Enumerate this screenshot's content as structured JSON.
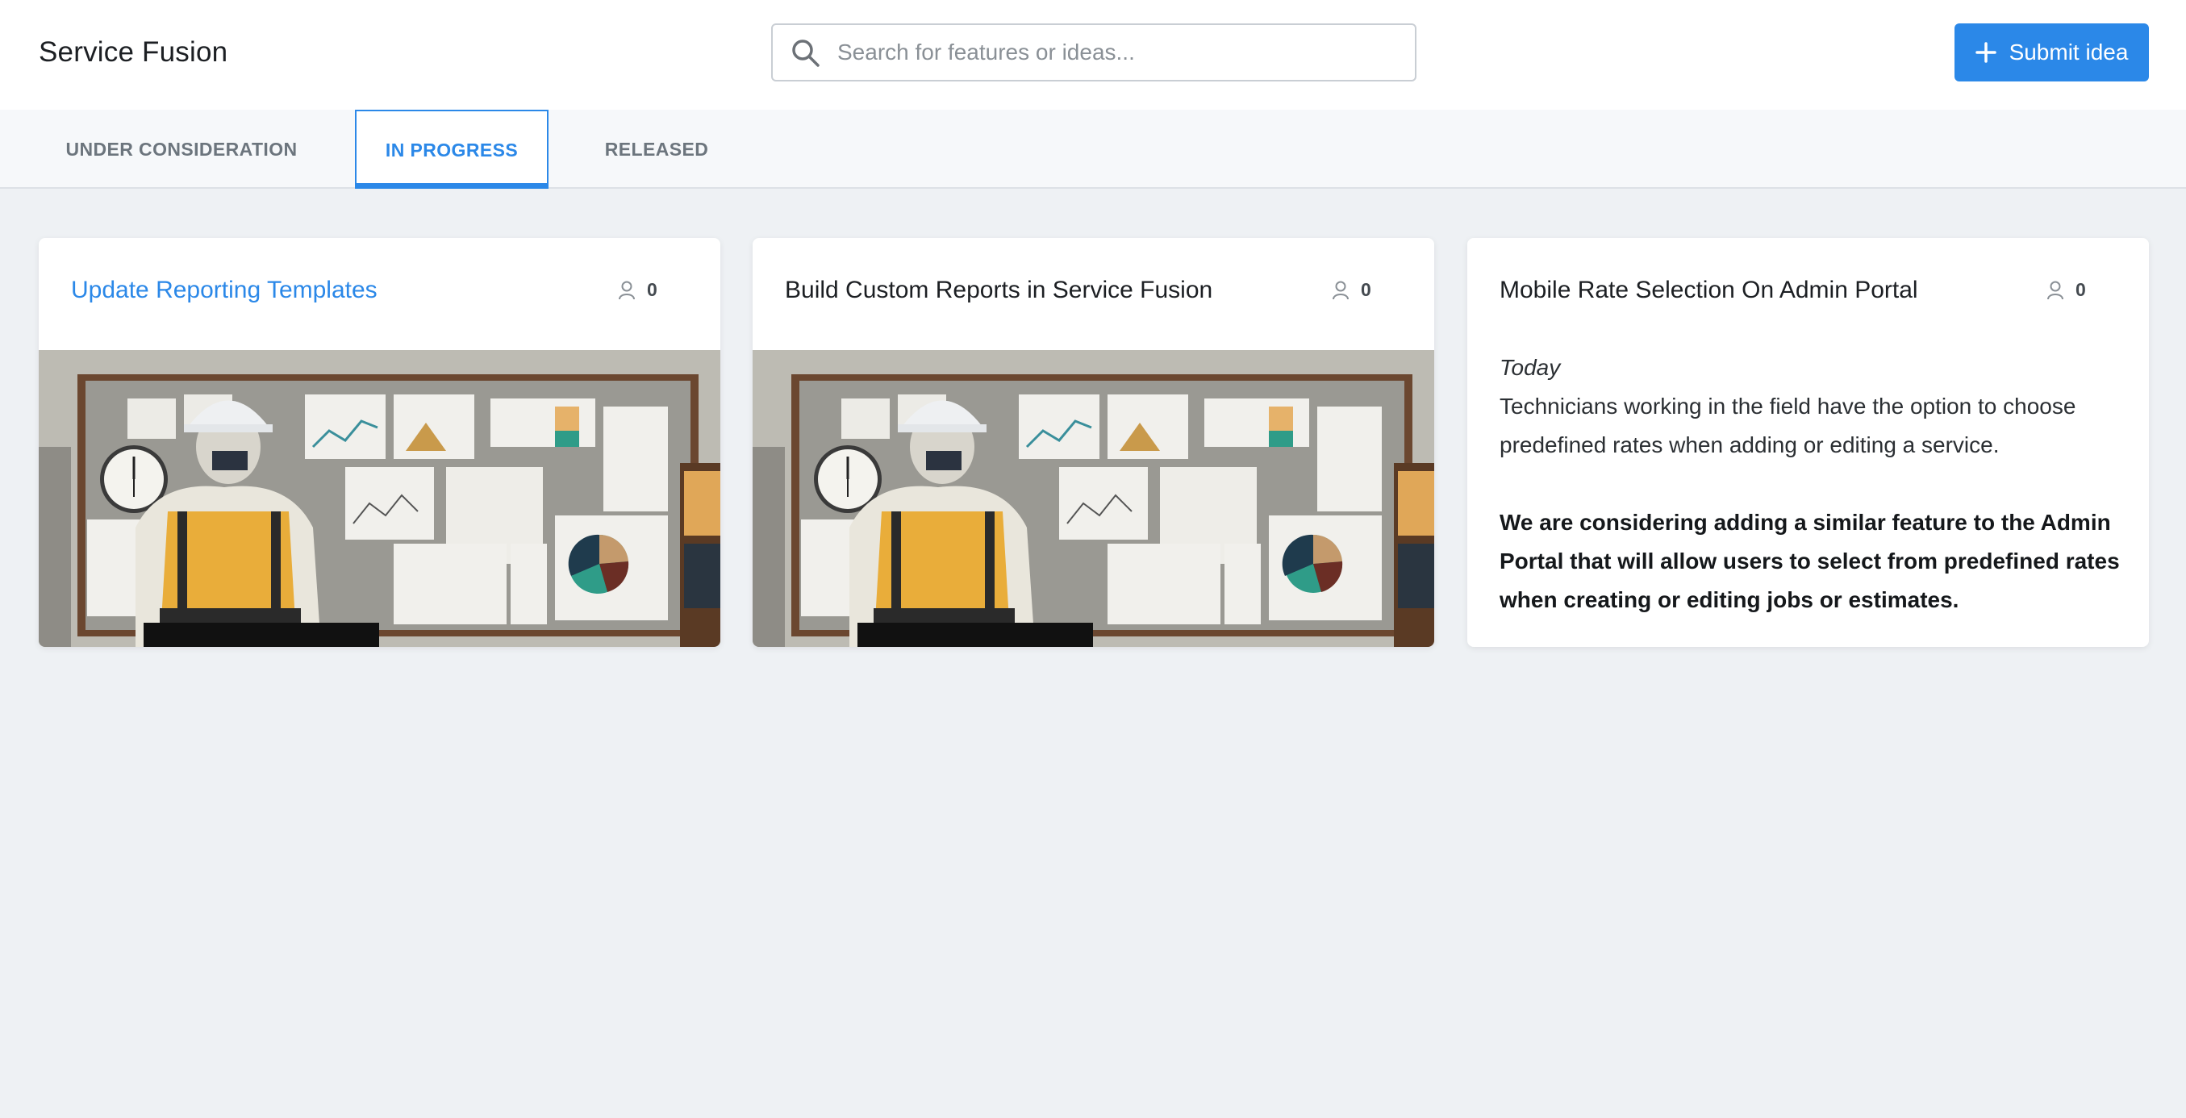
{
  "header": {
    "brand": "Service Fusion",
    "search_placeholder": "Search for features or ideas...",
    "submit_label": "Submit idea"
  },
  "tabs": [
    {
      "label": "UNDER CONSIDERATION",
      "active": false
    },
    {
      "label": "IN PROGRESS",
      "active": true
    },
    {
      "label": "RELEASED",
      "active": false
    }
  ],
  "cards": [
    {
      "title": "Update Reporting Templates",
      "votes": "0",
      "has_image": true
    },
    {
      "title": "Build Custom Reports in Service Fusion",
      "votes": "0",
      "has_image": true
    },
    {
      "title": "Mobile Rate Selection On Admin Portal",
      "votes": "0",
      "date": "Today",
      "description": "Technicians working in the field have the option to choose predefined rates when adding or editing a service.",
      "bold_text": "We are considering adding a similar feature to the Admin Portal that will allow users to select from predefined rates when creating or editing jobs or estimates."
    }
  ],
  "colors": {
    "accent": "#2b88e8",
    "background": "#eef1f4"
  }
}
